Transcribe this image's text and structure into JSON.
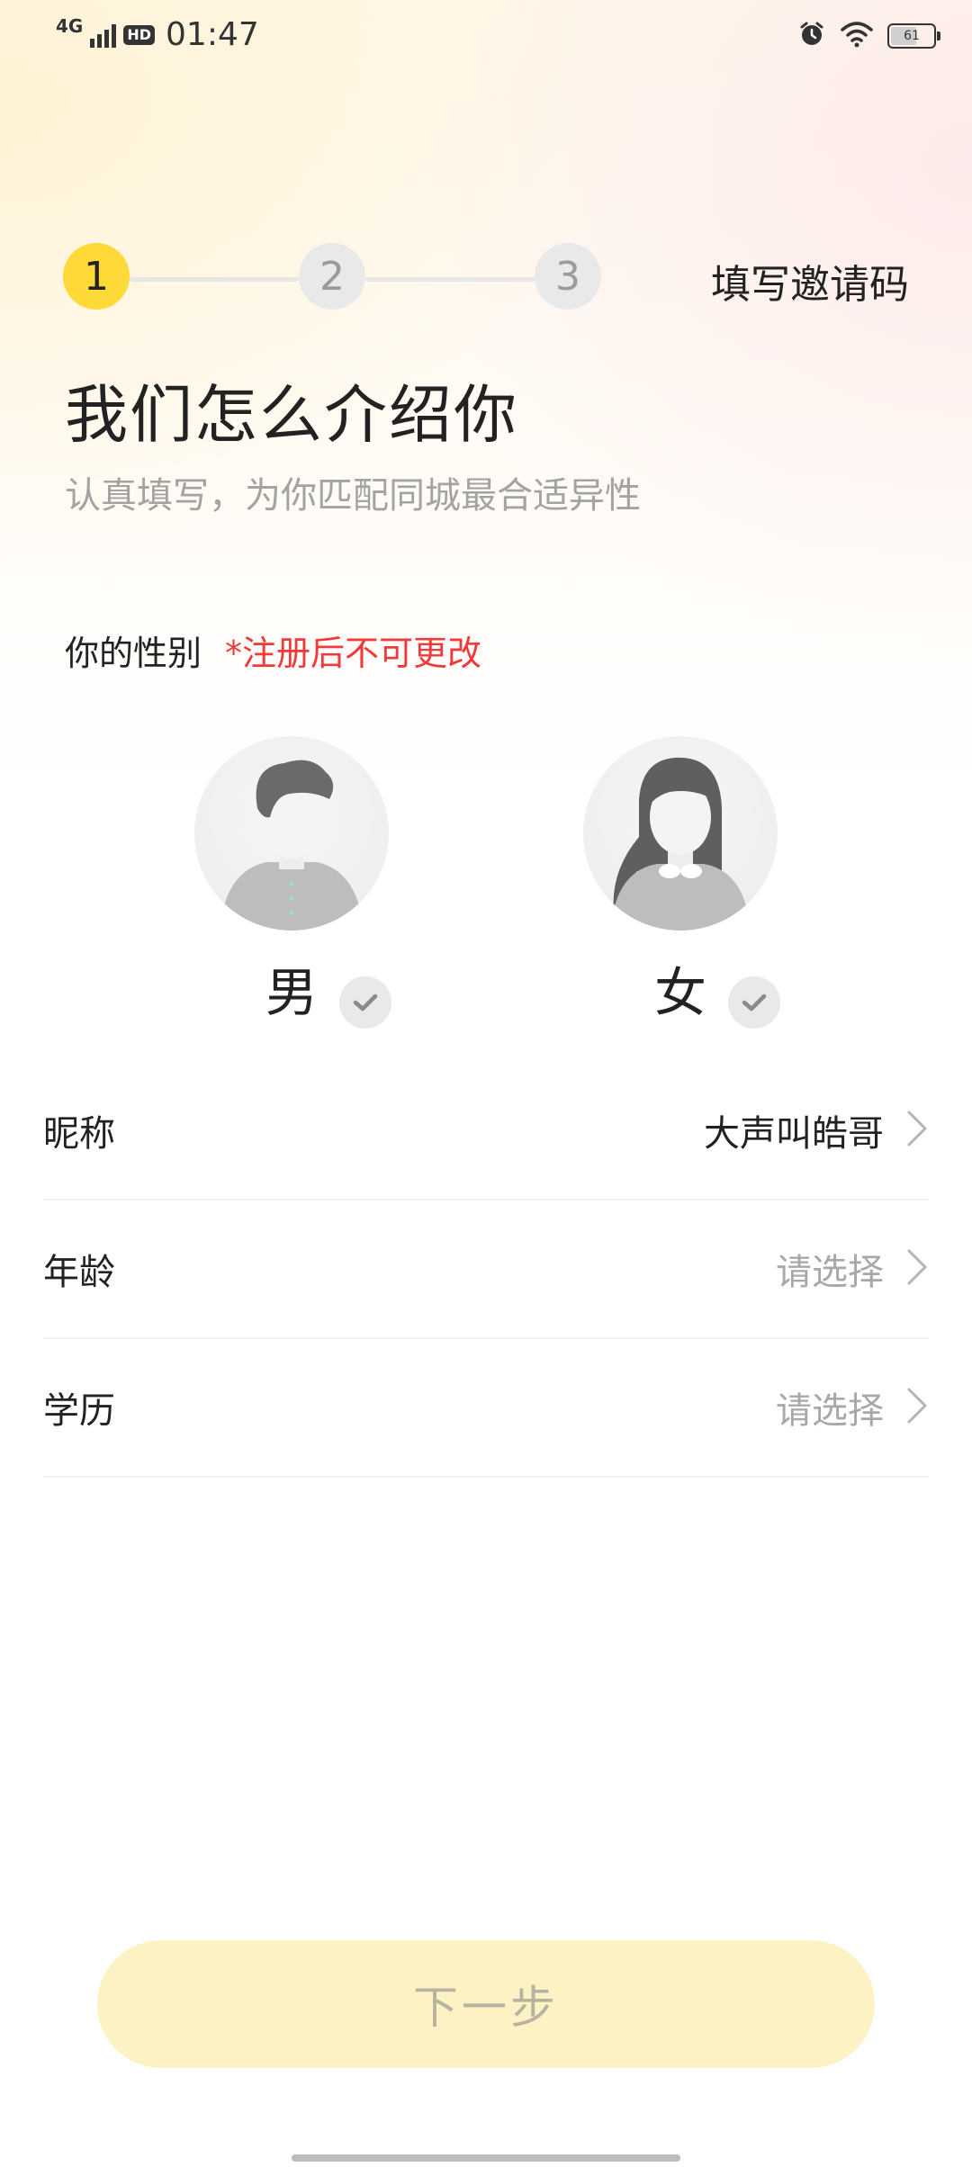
{
  "status_bar": {
    "network": "4G",
    "hd": "HD",
    "time": "01:47",
    "battery": "61"
  },
  "stepper": {
    "steps": [
      "1",
      "2",
      "3"
    ],
    "active_step": 1,
    "invite_label": "填写邀请码"
  },
  "page": {
    "title": "我们怎么介绍你",
    "subtitle": "认真填写，为你匹配同城最合适异性"
  },
  "gender": {
    "label": "你的性别",
    "warning": "*注册后不可更改",
    "options": [
      {
        "label": "男",
        "icon": "male-avatar-icon"
      },
      {
        "label": "女",
        "icon": "female-avatar-icon"
      }
    ]
  },
  "form": {
    "rows": [
      {
        "label": "昵称",
        "value": "大声叫皓哥",
        "is_placeholder": false
      },
      {
        "label": "年龄",
        "value": "请选择",
        "is_placeholder": true
      },
      {
        "label": "学历",
        "value": "请选择",
        "is_placeholder": true
      }
    ]
  },
  "actions": {
    "next_label": "下一步"
  },
  "colors": {
    "accent": "#fed938",
    "warning": "#f03a3a",
    "button_bg": "#fdf2c4"
  }
}
